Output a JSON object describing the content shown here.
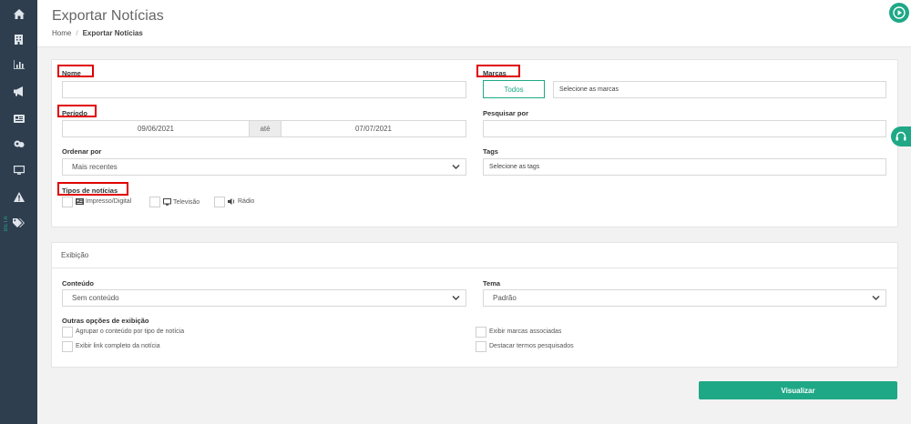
{
  "sidebar": {
    "items": [
      {
        "icon": "home-icon"
      },
      {
        "icon": "building-icon"
      },
      {
        "icon": "chart-icon"
      },
      {
        "icon": "megaphone-icon"
      },
      {
        "icon": "newspaper-icon"
      },
      {
        "icon": "handshake-icon"
      },
      {
        "icon": "monitor-icon"
      },
      {
        "icon": "warning-icon"
      },
      {
        "icon": "tags-icon"
      }
    ],
    "beta": "BETA"
  },
  "header": {
    "title": "Exportar Notícias",
    "breadcrumb": {
      "home": "Home",
      "sep": "/",
      "current": "Exportar Notícias"
    }
  },
  "filters": {
    "nome_label": "Nome",
    "nome_value": "",
    "marcas_label": "Marcas",
    "todos_label": "Todos",
    "marcas_placeholder": "Selecione as marcas",
    "periodo_label": "Período",
    "date_from": "09/06/2021",
    "ate": "até",
    "date_to": "07/07/2021",
    "pesquisar_label": "Pesquisar por",
    "ordenar_label": "Ordenar por",
    "ordenar_value": "Mais recentes",
    "tags_label": "Tags",
    "tags_placeholder": "Selecione as tags",
    "tipos_label": "Tipos de notícias",
    "tipos": [
      "Impresso/Digital",
      "Televisão",
      "Rádio"
    ]
  },
  "exibicao": {
    "title": "Exibição",
    "conteudo_label": "Conteúdo",
    "conteudo_value": "Sem conteúdo",
    "tema_label": "Tema",
    "tema_value": "Padrão",
    "outras_label": "Outras opções de exibição",
    "options": [
      "Agrupar o conteúdo por tipo de notícia",
      "Exibir link completo da notícia",
      "Exibir marcas associadas",
      "Destacar termos pesquisados"
    ]
  },
  "visualizar_label": "Visualizar",
  "colors": {
    "accent": "#1fa886",
    "sidebar": "#2e3e4e",
    "highlight": "#e00000"
  }
}
